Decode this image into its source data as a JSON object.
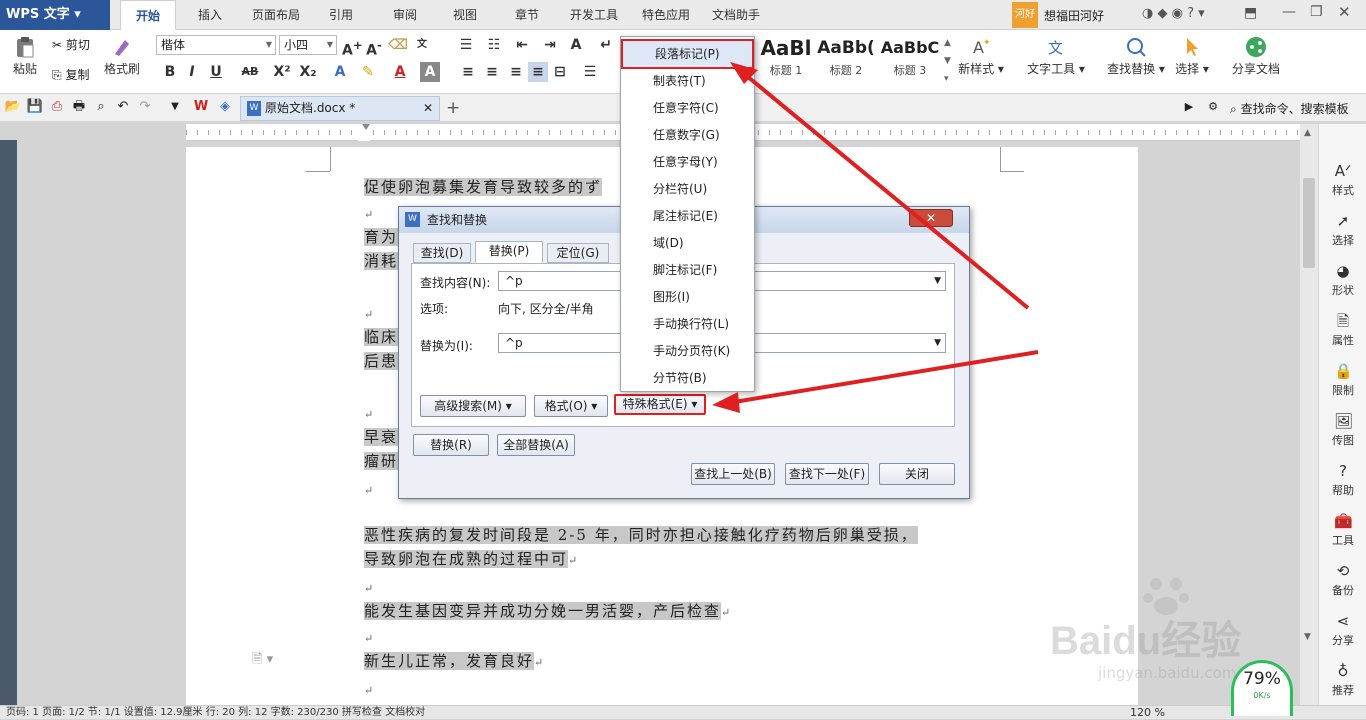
{
  "app": {
    "title": "WPS 文字",
    "menu_tabs": [
      "开始",
      "插入",
      "页面布局",
      "引用",
      "审阅",
      "视图",
      "章节",
      "开发工具",
      "特色应用",
      "文档助手"
    ],
    "user": "想福田河好",
    "user_badge": "河好"
  },
  "ribbon": {
    "paste": "粘贴",
    "cut": "剪切",
    "copy": "复制",
    "format_painter": "格式刷",
    "font_name": "楷体",
    "font_size": "小四",
    "styles": [
      {
        "preview": "AaBl",
        "label": "标题 1"
      },
      {
        "preview": "AaBb(",
        "label": "标题 2"
      },
      {
        "preview": "AaBbC",
        "label": "标题 3"
      }
    ],
    "new_style": "新样式",
    "text_tools": "文字工具",
    "find_replace": "查找替换",
    "select": "选择",
    "share_doc": "分享文档"
  },
  "quickbar": {
    "doc_tab": "原始文档.docx *",
    "search_placeholder": "查找命令、搜索模板"
  },
  "document": {
    "lines": [
      "促使卵泡募集发育导致较多的ず",
      "育为",
      "消耗",
      "临床",
      "后患",
      "早衰",
      "瘤研",
      "恶性疾病的复发时间段是 2-5 年，同时亦担心接触化疗药物后卵巢受损，",
      "导致卵泡在成熟的过程中可",
      "能发生基因变异并成功分娩一男活婴，产后检查",
      "新生儿正常，发育良好"
    ]
  },
  "dialog": {
    "title": "查找和替换",
    "close": "✕",
    "tabs": [
      "查找(D)",
      "替换(P)",
      "定位(G)"
    ],
    "find_label": "查找内容(N):",
    "find_value": "^p",
    "options_label": "选项:",
    "options_value": "向下, 区分全/半角",
    "replace_label": "替换为(I):",
    "replace_value": "^p",
    "advanced_search": "高级搜索(M) ▾",
    "format": "格式(O) ▾",
    "special_format": "特殊格式(E) ▾",
    "replace_btn": "替换(R)",
    "replace_all_btn": "全部替换(A)",
    "find_prev": "查找上一处(B)",
    "find_next": "查找下一处(F)",
    "close_btn": "关闭"
  },
  "special_menu": {
    "items": [
      "段落标记(P)",
      "制表符(T)",
      "任意字符(C)",
      "任意数字(G)",
      "任意字母(Y)",
      "分栏符(U)",
      "尾注标记(E)",
      "域(D)",
      "脚注标记(F)",
      "图形(I)",
      "手动换行符(L)",
      "手动分页符(K)",
      "分节符(B)"
    ]
  },
  "right_panel": [
    "样式",
    "选择",
    "形状",
    "属性",
    "限制",
    "传图",
    "帮助",
    "工具",
    "备份",
    "分享",
    "推荐"
  ],
  "status": {
    "left": "页码: 1  页面: 1/2  节: 1/1  设置值: 12.9厘米  行: 20  列: 12  字数: 230/230  拼写检查  文档校对",
    "zoom": "120 %",
    "speed_pct": "79%",
    "speed_rate": "0K/s"
  },
  "watermark": {
    "brand": "Baidu经验",
    "url": "jingyan.baidu.com"
  },
  "colors": {
    "accent": "#2b579a",
    "highlight_red": "#e02020",
    "selection_gray": "#c8c8c8"
  }
}
